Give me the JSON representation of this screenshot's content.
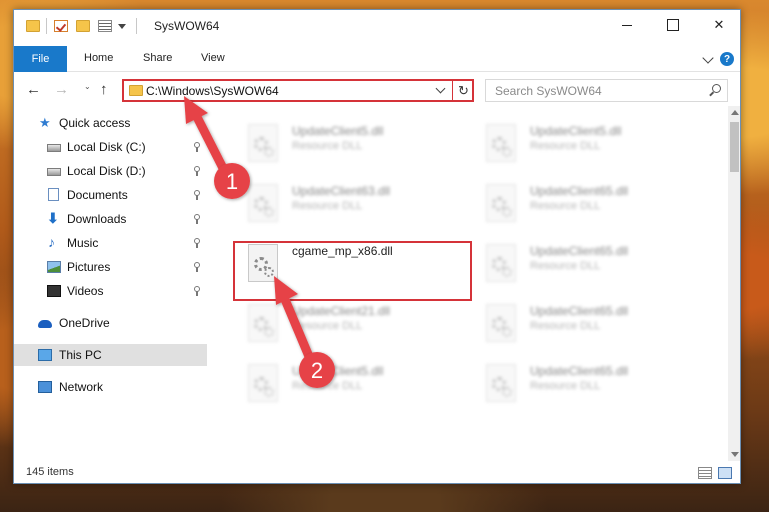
{
  "window": {
    "title": "SysWOW64"
  },
  "ribbon": {
    "tabs": [
      "File",
      "Home",
      "Share",
      "View"
    ],
    "help": "?"
  },
  "navigation": {
    "back": "←",
    "forward": "→",
    "recent": "⌄",
    "up": "↑",
    "address": "C:\\Windows\\SysWOW64",
    "refresh": "↻",
    "search_placeholder": "Search SysWOW64"
  },
  "sidebar": {
    "items": [
      {
        "label": "Quick access",
        "icon": "star-icon"
      },
      {
        "label": "Local Disk (C:)",
        "icon": "drive-icon",
        "pinned": true
      },
      {
        "label": "Local Disk (D:)",
        "icon": "drive-icon",
        "pinned": true
      },
      {
        "label": "Documents",
        "icon": "documents-icon",
        "pinned": true
      },
      {
        "label": "Downloads",
        "icon": "downloads-icon",
        "pinned": true
      },
      {
        "label": "Music",
        "icon": "music-icon",
        "pinned": true
      },
      {
        "label": "Pictures",
        "icon": "pictures-icon",
        "pinned": true
      },
      {
        "label": "Videos",
        "icon": "videos-icon",
        "pinned": true
      },
      {
        "label": "OneDrive",
        "icon": "onedrive-icon"
      },
      {
        "label": "This PC",
        "icon": "this-pc-icon",
        "selected": true
      },
      {
        "label": "Network",
        "icon": "network-icon"
      }
    ]
  },
  "files": {
    "left": [
      {
        "name": "UpdateClient5.dll",
        "type": "Resource DLL"
      },
      {
        "name": "UpdateClient63.dll",
        "type": "Resource DLL"
      },
      {
        "name": "cgame_mp_x86.dll",
        "type": ""
      },
      {
        "name": "UpdateClient21.dll",
        "type": "Resource DLL"
      },
      {
        "name": "UpdateClient5.dll",
        "type": "Resource DLL"
      }
    ],
    "right": [
      {
        "name": "UpdateClient5.dll",
        "type": "Resource DLL"
      },
      {
        "name": "UpdateClient65.dll",
        "type": "Resource DLL"
      },
      {
        "name": "UpdateClient65.dll",
        "type": "Resource DLL"
      },
      {
        "name": "UpdateClient65.dll",
        "type": "Resource DLL"
      },
      {
        "name": "UpdateClient65.dll",
        "type": "Resource DLL"
      }
    ]
  },
  "status": {
    "item_count": "145 items"
  },
  "annotations": {
    "step1": "1",
    "step2": "2"
  },
  "colors": {
    "accent": "#1979ca",
    "highlight": "#d53339",
    "selected_bg": "#e0e0e0"
  }
}
